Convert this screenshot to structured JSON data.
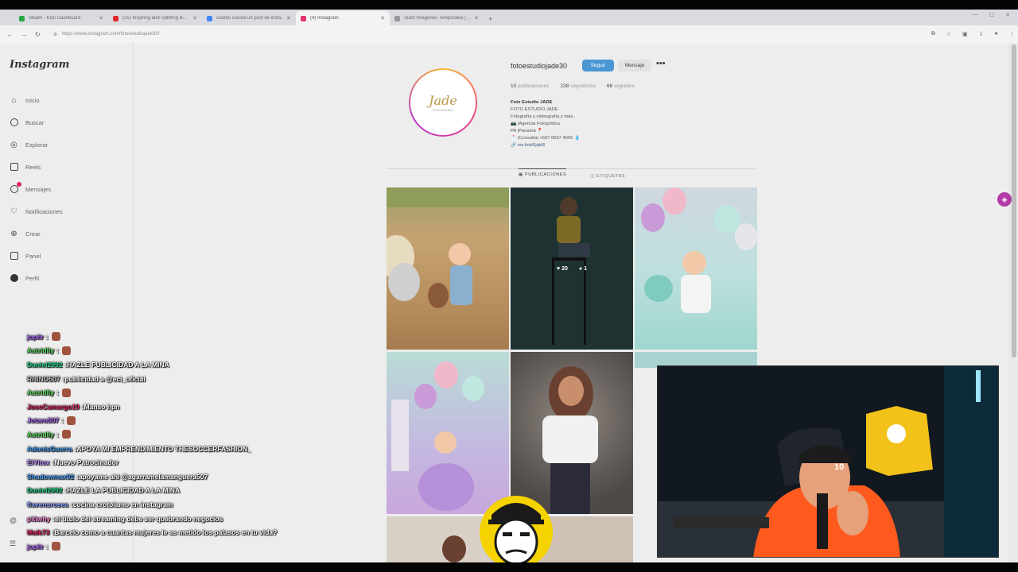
{
  "browser": {
    "tabs": [
      {
        "title": "Steam - Kick Dashboard",
        "color": "#28a745"
      },
      {
        "title": "(25) Inspiring and Uplifting B...",
        "color": "#e02828"
      },
      {
        "title": "cuanto cuesta un post de insta...",
        "color": "#4285f4"
      },
      {
        "title": "(4) Instagram",
        "color": "#e1306c"
      },
      {
        "title": "Subir Imagenes Temporales | ...",
        "color": "#999999"
      }
    ],
    "active_tab": 3,
    "url": "https://www.instagram.com/fotoestudiojade30/"
  },
  "sidebar": {
    "logo": "Instagram",
    "items": [
      {
        "label": "Inicio",
        "icon": "home-icon"
      },
      {
        "label": "Buscar",
        "icon": "search-icon"
      },
      {
        "label": "Explorar",
        "icon": "compass-icon"
      },
      {
        "label": "Reels",
        "icon": "reels-icon"
      },
      {
        "label": "Mensajes",
        "icon": "messenger-icon"
      },
      {
        "label": "Notificaciones",
        "icon": "heart-icon"
      },
      {
        "label": "Crear",
        "icon": "plus-square-icon"
      },
      {
        "label": "Panel",
        "icon": "dashboard-icon"
      },
      {
        "label": "Perfil",
        "icon": "avatar-icon"
      }
    ]
  },
  "profile": {
    "username": "fotoestudiojade30",
    "follow_label": "Seguir",
    "message_label": "Mensaje",
    "more_label": "•••",
    "posts_count": "10",
    "posts_label": "publicaciones",
    "followers_count": "238",
    "followers_label": "seguidores",
    "following_count": "68",
    "following_label": "seguidos",
    "bio_name": "Foto Estudio JADE",
    "bio_lines": [
      "FOTO ESTUDIO JADE",
      "Fotografía y videografía y más..",
      "📷 |Agencia Fotográfica",
      "PA |Panamá 📍",
      "📩 |Consulta| +507 6657 4500 💧"
    ],
    "bio_link": "wa.link/6jqkl6",
    "pic_text": "Jade",
    "pic_subtext": "FOTO ESTUDIO"
  },
  "profile_tabs": [
    {
      "label": "PUBLICACIONES",
      "icon": "grid-icon",
      "active": true
    },
    {
      "label": "ETIQUETAS",
      "icon": "tag-icon",
      "active": false
    }
  ],
  "hover_post": {
    "likes": "20",
    "comments": "1"
  },
  "chat": [
    {
      "user": "jopiir",
      "color": "#b36cff",
      "msg": ""
    },
    {
      "user": "Astridlly",
      "color": "#5ee05e",
      "msg": ""
    },
    {
      "user": "Daniel2992",
      "color": "#22d98a",
      "msg": "HAZLE PUBLICIDAD A LA MINA"
    },
    {
      "user": "RHINO507",
      "color": "#c4c4c4",
      "msg": "publicidad a @eci_oficial"
    },
    {
      "user": "Astridlly",
      "color": "#5ee05e",
      "msg": ""
    },
    {
      "user": "JoseCamargo19",
      "color": "#e0245e",
      "msg": "Manso hpn"
    },
    {
      "user": "Jotaro507",
      "color": "#b36cff",
      "msg": ""
    },
    {
      "user": "Astridlly",
      "color": "#5ee05e",
      "msg": ""
    },
    {
      "user": "AdonisGuerra",
      "color": "#4aa3ff",
      "msg": "APOYA MI EMPRENDIMIENTO THESOCCERFASHION_"
    },
    {
      "user": "ElYitox",
      "color": "#c08cff",
      "msg": "Nuevo Patrocinador"
    },
    {
      "user": "Shadowmax92",
      "color": "#4aa3ff",
      "msg": "apoyame ahi @agarramelamanguera507"
    },
    {
      "user": "Daniel2992",
      "color": "#22d98a",
      "msg": "HAZLE LA PUBLICIDAD A LA MINA"
    },
    {
      "user": "flavensrosea",
      "color": "#8aa0ff",
      "msg": "cocina crotolamo en instagram"
    },
    {
      "user": "pitiwhy",
      "color": "#ff8ad8",
      "msg": "el titulo del streaming debe ser quebrando negocios"
    },
    {
      "user": "Maik73",
      "color": "#e0245e",
      "msg": "Barcelo como a cuantas mujeres le as metido los palasos en tu vida?"
    },
    {
      "user": "jopiir",
      "color": "#b36cff",
      "msg": ""
    }
  ],
  "webcam": {
    "cap_text": "10"
  }
}
